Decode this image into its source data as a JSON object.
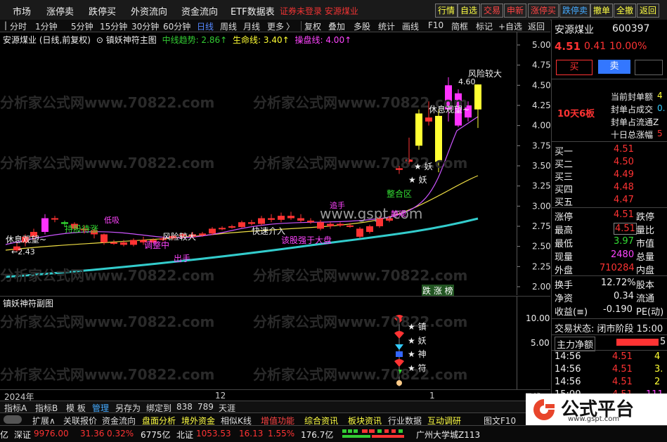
{
  "menu": {
    "items": [
      "市场",
      "涨停卖",
      "跌停买",
      "外资流向",
      "资金流向",
      "ETF数据表"
    ],
    "warning": "证券未登录  安源煤业",
    "right_buttons": [
      "行情",
      "自选",
      "交易",
      "申新",
      "涨停买",
      "跌停卖",
      "撤单",
      "全撤",
      "返回"
    ]
  },
  "toolbar": {
    "periods": [
      "分时",
      "1分钟",
      "5分钟",
      "15分钟",
      "30分钟",
      "60分钟",
      "日线",
      "周线",
      "月线",
      "更多"
    ],
    "selected": "日线",
    "tools": [
      "复权",
      "叠加",
      "多股",
      "统计",
      "画线",
      "F10",
      "简框",
      "标记",
      "+自选",
      "返回"
    ]
  },
  "main": {
    "title": "安源煤业 (日线,前复权)",
    "indicator_name": "镇妖神符主图",
    "ind1": "中线趋势: 2.86↑",
    "ind2": "生命线: 3.40↑",
    "ind3": "操盘线: 4.00↑",
    "annotations": {
      "risk1": "风险较大",
      "risk2": "风险较大",
      "rest1": "休息观望~",
      "rest2": "休息观望~",
      "low": "←2.43",
      "high": "4.60",
      "buy1": "★ 妖",
      "buy2": "★ 妖",
      "consolidation": "整合区",
      "fastin": "快速介入",
      "stronger": "该股强于大盘",
      "exit": "出手",
      "hold": "持股待涨",
      "adjust": "调整中",
      "lure": "低吸",
      "track": "追手",
      "watch": "静观",
      "stage": "跌 涨 榜"
    },
    "watermark1": "分析家公式网www.70822.com",
    "watermark2": "www.gspt.com",
    "y_ticks": [
      "5.00",
      "4.75",
      "4.50",
      "4.25",
      "4.00",
      "3.75",
      "3.50",
      "3.25",
      "3.00",
      "2.75",
      "2.50",
      "2.25",
      "2.00"
    ]
  },
  "sub": {
    "title": "镇妖神符副图",
    "y_ticks": [
      "10.00",
      "5.00"
    ],
    "labels": [
      "★ 镇",
      "★ 妖",
      "★ 神",
      "★ 符"
    ]
  },
  "axis": {
    "year": "2024年",
    "m12": "12",
    "m1": "1",
    "day": "日线"
  },
  "tabs": [
    "指标A",
    "指标B",
    "模 板",
    "管理",
    "另存为",
    "绑定到",
    "838",
    "789",
    "天涯"
  ],
  "func": [
    "扩展∧",
    "关联报价",
    "资金流向",
    "盘面分析",
    "境外资金",
    "相似K线",
    "增值功能",
    "综合资讯",
    "板块资讯",
    "行业数据",
    "互动调研",
    "图文F10"
  ],
  "status": {
    "a": "亿",
    "sz_name": "深证",
    "sz_val": "9976.00",
    "sz_chg": "31.36",
    "sz_pct": "0.32%",
    "sz_amt": "6775亿",
    "bz_name": "北证",
    "bz_val": "1053.53",
    "bz_chg": "16.13",
    "bz_pct": "1.55%",
    "bz_amt": "176.7亿",
    "news": "广州大学城Z113"
  },
  "quote": {
    "name": "安源煤业",
    "code": "600397",
    "price": "4.51",
    "change": "0.41",
    "pct": "10.00%",
    "buy": "买",
    "sell": "卖",
    "streak": "10天6板",
    "info": [
      "当前封单额",
      "封单占成交",
      "封单占流通Z",
      "十日总涨幅"
    ],
    "info_vals": [
      "4",
      "0.",
      "",
      "5"
    ],
    "bids": [
      {
        "label": "买一",
        "price": "4.51"
      },
      {
        "label": "买二",
        "price": "4.50"
      },
      {
        "label": "买三",
        "price": "4.49"
      },
      {
        "label": "买四",
        "price": "4.48"
      },
      {
        "label": "买五",
        "price": "4.47"
      }
    ],
    "stats": [
      {
        "l": "涨停",
        "v": "4.51",
        "r": "跌停"
      },
      {
        "l": "最高",
        "v": "4.51",
        "r": "量比"
      },
      {
        "l": "最低",
        "v": "3.97",
        "r": "市值"
      },
      {
        "l": "现量",
        "v": "2480",
        "r": "总量"
      },
      {
        "l": "外盘",
        "v": "710284",
        "r": "内盘"
      },
      {
        "l": "换手",
        "v": "12.72%",
        "r": "股本"
      },
      {
        "l": "净资",
        "v": "0.34",
        "r": "流通"
      },
      {
        "l": "收益(≡)",
        "v": "-0.190",
        "r": "PE(动)"
      }
    ],
    "state": "交易状态: 闭市阶段 15:00",
    "netflow": "主力净额",
    "netflow_val": "5",
    "ticks": [
      {
        "t": "14:56",
        "p": "4.51",
        "v": "4"
      },
      {
        "t": "14:56",
        "p": "4.51",
        "v": "3."
      },
      {
        "t": "14:56",
        "p": "4.51",
        "v": "2"
      },
      {
        "t": "15:00",
        "p": "4.51",
        "v": "111"
      }
    ]
  },
  "logo": {
    "text": "公式平台",
    "url": "www.gspt.com"
  },
  "colors": {
    "up": "#ff3333",
    "down": "#33dd33",
    "yellow": "#ffff33",
    "cyan": "#33cccc",
    "magenta": "#ff44ff",
    "purple": "#cc55ff"
  }
}
